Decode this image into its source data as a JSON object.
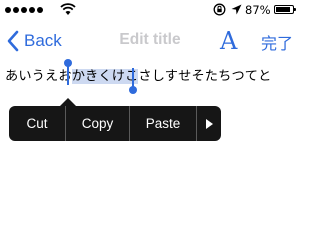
{
  "status_bar": {
    "battery_percent": "87%",
    "battery_level": 0.87
  },
  "nav": {
    "back_label": "Back",
    "title": "Edit title",
    "font_button_label": "A",
    "done_label": "完了"
  },
  "editor": {
    "text_before": "あいうえお",
    "text_selected": "かきくけこ",
    "text_after": "さしすせそたちつてと"
  },
  "edit_menu": {
    "items": [
      {
        "label": "Cut"
      },
      {
        "label": "Copy"
      },
      {
        "label": "Paste"
      }
    ]
  },
  "colors": {
    "accent": "#2f6bdc",
    "selection": "#cdd9f1",
    "menu_bg": "#161616",
    "title_gray": "#c9c9cc"
  }
}
